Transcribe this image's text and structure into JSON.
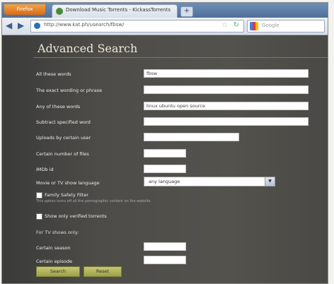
{
  "browser": {
    "app_button": "Firefox",
    "tab_title": "Download Music Torrents - KickassTorrents",
    "new_tab": "+",
    "url": "http://www.kat.ph/usearch/fbsw/",
    "search_placeholder": "Google"
  },
  "page": {
    "title": "Advanced Search",
    "fields": [
      {
        "label": "All these words",
        "value": "fbsw"
      },
      {
        "label": "The exact wording or phrase",
        "value": ""
      },
      {
        "label": "Any of these words",
        "value": "linux ubuntu open source"
      },
      {
        "label": "Subtract specified word",
        "value": ""
      },
      {
        "label": "Uploads by certain user",
        "value": ""
      },
      {
        "label": "Certain number of files",
        "value": ""
      },
      {
        "label": "IMDb id",
        "value": ""
      }
    ],
    "language": {
      "label": "Movie or TV show language",
      "selected": "any language"
    },
    "family_filter": {
      "label": "Family Safety Filter",
      "note": "This option turns off all the pornographic content on the website"
    },
    "verified_only": {
      "label": "Show only verified torrents"
    },
    "tv_shows": {
      "heading": "For TV shows only:",
      "season_label": "Certain season",
      "episode_label": "Certain episode"
    },
    "buttons": {
      "search": "Search",
      "reset": "Reset"
    }
  },
  "colors": {
    "accent": "#a8ad55",
    "background": "#4d4c48"
  }
}
